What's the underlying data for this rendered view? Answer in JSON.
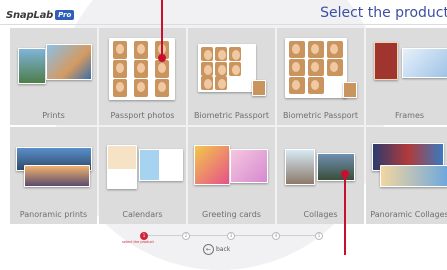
{
  "header": {
    "logo_text": "SnapLab",
    "logo_badge": "Pro",
    "title": "Select the product"
  },
  "products": [
    {
      "label": "Prints"
    },
    {
      "label": "Passport photos"
    },
    {
      "label": "Biometric Passport"
    },
    {
      "label": "Biometric Passport"
    },
    {
      "label": "Frames"
    },
    {
      "label": "Panoramic prints"
    },
    {
      "label": "Calendars"
    },
    {
      "label": "Greeting cards"
    },
    {
      "label": "Collages"
    },
    {
      "label": "Panoramic Collages"
    }
  ],
  "progress": {
    "steps": [
      "1",
      "2",
      "3",
      "4",
      "5"
    ],
    "active_step": 1,
    "active_caption": "select the product"
  },
  "footer": {
    "back_icon": "back-arrow-icon",
    "back_label": "back"
  },
  "colors": {
    "accent": "#3d4fa3",
    "brand_badge": "#2f5fb8",
    "tile_bg": "#dcdcdc",
    "marker": "#c8102e"
  }
}
